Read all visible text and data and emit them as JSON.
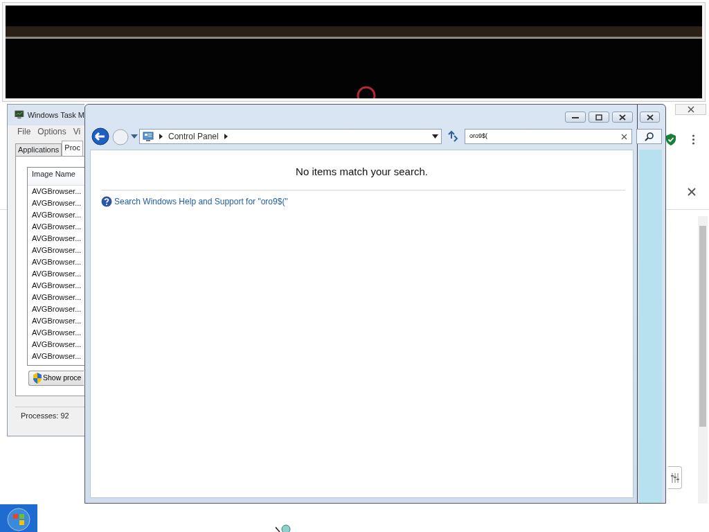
{
  "task_manager": {
    "title": "Windows Task M",
    "menu": [
      "File",
      "Options",
      "Vi"
    ],
    "tabs": [
      {
        "label": "Applications",
        "selected": false
      },
      {
        "label": "Proc",
        "selected": true
      }
    ],
    "column": "Image Name",
    "rows": [
      "AVGBrowser...",
      "AVGBrowser...",
      "AVGBrowser...",
      "AVGBrowser...",
      "AVGBrowser...",
      "AVGBrowser...",
      "AVGBrowser...",
      "AVGBrowser...",
      "AVGBrowser...",
      "AVGBrowser...",
      "AVGBrowser...",
      "AVGBrowser...",
      "AVGBrowser...",
      "AVGBrowser...",
      "AVGBrowser..."
    ],
    "button": "Show proce",
    "status": "Processes: 92"
  },
  "control_panel": {
    "breadcrumb": [
      "Control Panel"
    ],
    "search": {
      "value": "oro9$("
    },
    "message": "No items match your search.",
    "help_link": "Search Windows Help and Support for \"oro9$(\""
  }
}
